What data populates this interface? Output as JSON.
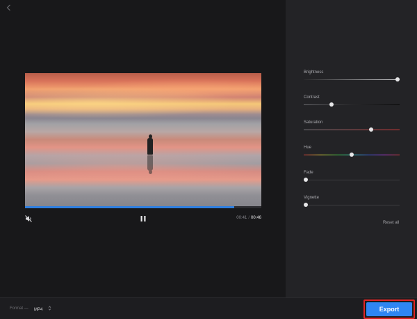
{
  "player": {
    "current_time": "00:41",
    "separator": "/",
    "total_time": "00:46",
    "progress_fraction": 0.885
  },
  "adjustments": [
    {
      "label": "Brightness",
      "value": 0.99,
      "track": "brightness"
    },
    {
      "label": "Contrast",
      "value": 0.29,
      "track": "contrast"
    },
    {
      "label": "Saturation",
      "value": 0.7,
      "track": "saturation"
    },
    {
      "label": "Hue",
      "value": 0.5,
      "track": "hue"
    },
    {
      "label": "Fade",
      "value": 0.0,
      "track": "plain"
    },
    {
      "label": "Vignette",
      "value": 0.0,
      "track": "plain"
    }
  ],
  "reset_label": "Reset all",
  "footer": {
    "format_label": "Format —",
    "format_value": "MP4",
    "export_label": "Export"
  },
  "colors": {
    "accent": "#2f86f2",
    "highlight": "#e12424"
  },
  "icons": {
    "back": "chevron-left-icon",
    "mute": "muted-speaker-icon",
    "pause": "pause-icon",
    "format": "chevron-up-down-icon"
  }
}
